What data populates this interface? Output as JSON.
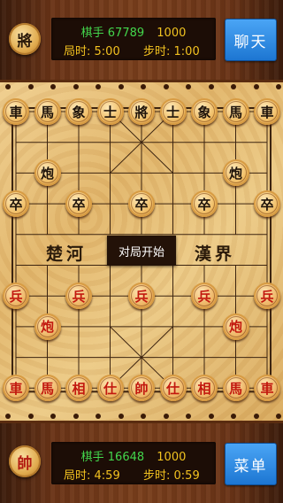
{
  "top_player": {
    "badge": "將",
    "rank_label": "棋手",
    "rank_number": "67789",
    "score": "1000",
    "game_time_label": "局时:",
    "game_time": "5:00",
    "step_time_label": "步时:",
    "step_time": "1:00",
    "action_button": "聊天"
  },
  "bottom_player": {
    "badge": "帥",
    "rank_label": "棋手",
    "rank_number": "16648",
    "score": "1000",
    "game_time_label": "局时:",
    "game_time": "4:59",
    "step_time_label": "步时:",
    "step_time": "0:59",
    "action_button": "菜单"
  },
  "board": {
    "river_left": "楚河",
    "river_right": "漢界",
    "status": "对局开始",
    "pieces": [
      {
        "name": "black-chariot-left",
        "side": "black",
        "char": "車",
        "file": 0,
        "rank": 0
      },
      {
        "name": "black-horse-left",
        "side": "black",
        "char": "馬",
        "file": 1,
        "rank": 0
      },
      {
        "name": "black-elephant-left",
        "side": "black",
        "char": "象",
        "file": 2,
        "rank": 0
      },
      {
        "name": "black-advisor-left",
        "side": "black",
        "char": "士",
        "file": 3,
        "rank": 0
      },
      {
        "name": "black-general",
        "side": "black",
        "char": "將",
        "file": 4,
        "rank": 0
      },
      {
        "name": "black-advisor-right",
        "side": "black",
        "char": "士",
        "file": 5,
        "rank": 0
      },
      {
        "name": "black-elephant-right",
        "side": "black",
        "char": "象",
        "file": 6,
        "rank": 0
      },
      {
        "name": "black-horse-right",
        "side": "black",
        "char": "馬",
        "file": 7,
        "rank": 0
      },
      {
        "name": "black-chariot-right",
        "side": "black",
        "char": "車",
        "file": 8,
        "rank": 0
      },
      {
        "name": "black-cannon-left",
        "side": "black",
        "char": "炮",
        "file": 1,
        "rank": 2
      },
      {
        "name": "black-cannon-right",
        "side": "black",
        "char": "炮",
        "file": 7,
        "rank": 2
      },
      {
        "name": "black-soldier-1",
        "side": "black",
        "char": "卒",
        "file": 0,
        "rank": 3
      },
      {
        "name": "black-soldier-2",
        "side": "black",
        "char": "卒",
        "file": 2,
        "rank": 3
      },
      {
        "name": "black-soldier-3",
        "side": "black",
        "char": "卒",
        "file": 4,
        "rank": 3
      },
      {
        "name": "black-soldier-4",
        "side": "black",
        "char": "卒",
        "file": 6,
        "rank": 3
      },
      {
        "name": "black-soldier-5",
        "side": "black",
        "char": "卒",
        "file": 8,
        "rank": 3
      },
      {
        "name": "red-soldier-1",
        "side": "red",
        "char": "兵",
        "file": 0,
        "rank": 6
      },
      {
        "name": "red-soldier-2",
        "side": "red",
        "char": "兵",
        "file": 2,
        "rank": 6
      },
      {
        "name": "red-soldier-3",
        "side": "red",
        "char": "兵",
        "file": 4,
        "rank": 6
      },
      {
        "name": "red-soldier-4",
        "side": "red",
        "char": "兵",
        "file": 6,
        "rank": 6
      },
      {
        "name": "red-soldier-5",
        "side": "red",
        "char": "兵",
        "file": 8,
        "rank": 6
      },
      {
        "name": "red-cannon-left",
        "side": "red",
        "char": "炮",
        "file": 1,
        "rank": 7
      },
      {
        "name": "red-cannon-right",
        "side": "red",
        "char": "炮",
        "file": 7,
        "rank": 7
      },
      {
        "name": "red-chariot-left",
        "side": "red",
        "char": "車",
        "file": 0,
        "rank": 9
      },
      {
        "name": "red-horse-left",
        "side": "red",
        "char": "馬",
        "file": 1,
        "rank": 9
      },
      {
        "name": "red-elephant-left",
        "side": "red",
        "char": "相",
        "file": 2,
        "rank": 9
      },
      {
        "name": "red-advisor-left",
        "side": "red",
        "char": "仕",
        "file": 3,
        "rank": 9
      },
      {
        "name": "red-general",
        "side": "red",
        "char": "帥",
        "file": 4,
        "rank": 9
      },
      {
        "name": "red-advisor-right",
        "side": "red",
        "char": "仕",
        "file": 5,
        "rank": 9
      },
      {
        "name": "red-elephant-right",
        "side": "red",
        "char": "相",
        "file": 6,
        "rank": 9
      },
      {
        "name": "red-horse-right",
        "side": "red",
        "char": "馬",
        "file": 7,
        "rank": 9
      },
      {
        "name": "red-chariot-right",
        "side": "red",
        "char": "車",
        "file": 8,
        "rank": 9
      }
    ]
  }
}
